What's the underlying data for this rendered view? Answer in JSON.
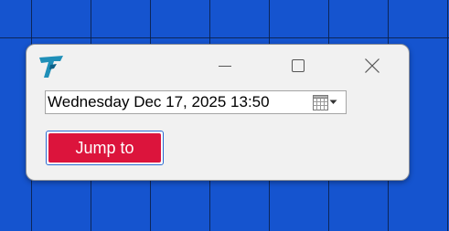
{
  "window": {
    "controls": {
      "minimize_icon": "minimize-icon",
      "maximize_icon": "maximize-icon",
      "close_icon": "close-icon"
    }
  },
  "date_picker": {
    "value": "Wednesday Dec 17, 2025 13:50",
    "calendar_icon": "calendar-icon",
    "dropdown_icon": "dropdown-arrow-icon"
  },
  "jump_button": {
    "label": "Jump to"
  },
  "colors": {
    "desktop_blue": "#1554cf",
    "accent_red": "#dc143c",
    "logo_teal": "#1f8fb8"
  }
}
